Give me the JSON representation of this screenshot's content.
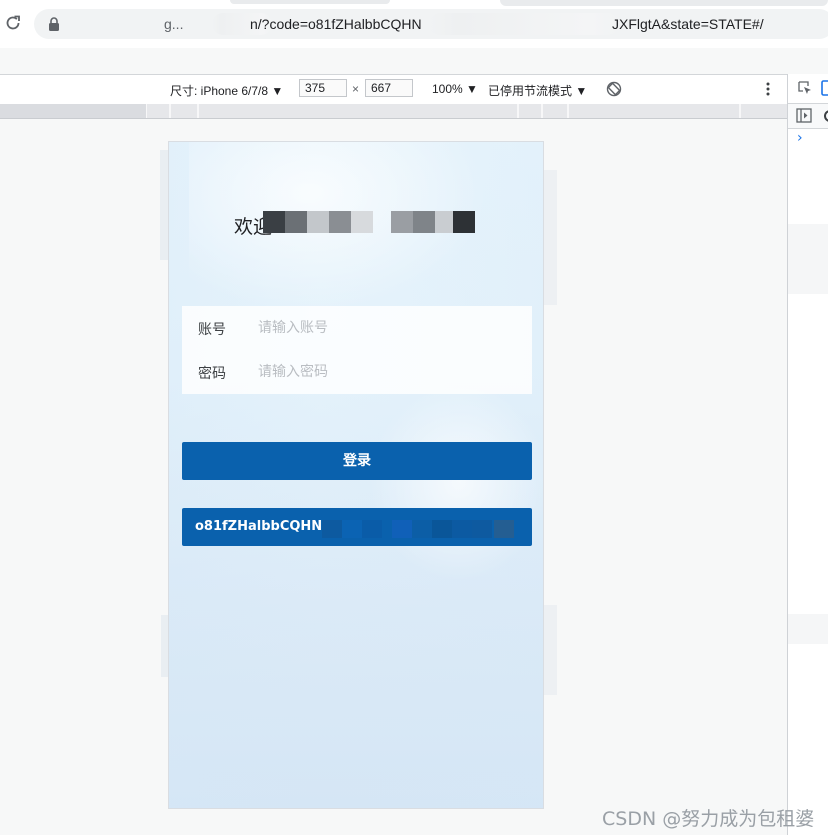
{
  "browser": {
    "url_host_fragment": "g...",
    "url_part_a": "n/?code=o81fZHalbbCQHN",
    "url_part_b": "JXFlgtA&state=STATE#/"
  },
  "device_toolbar": {
    "device_label": "尺寸: iPhone 6/7/8 ▼",
    "width_value": "375",
    "height_value": "667",
    "times_sign": "×",
    "zoom_label": "100% ▼",
    "throttle_label": "已停用节流模式 ▼"
  },
  "devtools_panel": {
    "console_prompt": "›"
  },
  "page": {
    "welcome_prefix": "欢迎",
    "account_label": "账号",
    "account_placeholder": "请输入账号",
    "password_label": "密码",
    "password_placeholder": "请输入密码",
    "login_button": "登录",
    "code_text": "o81fZHalbbCQHN"
  },
  "watermark": "CSDN @努力成为包租婆",
  "colors": {
    "primary_button": "#0a61ad",
    "console_prompt": "#1a73e8"
  }
}
